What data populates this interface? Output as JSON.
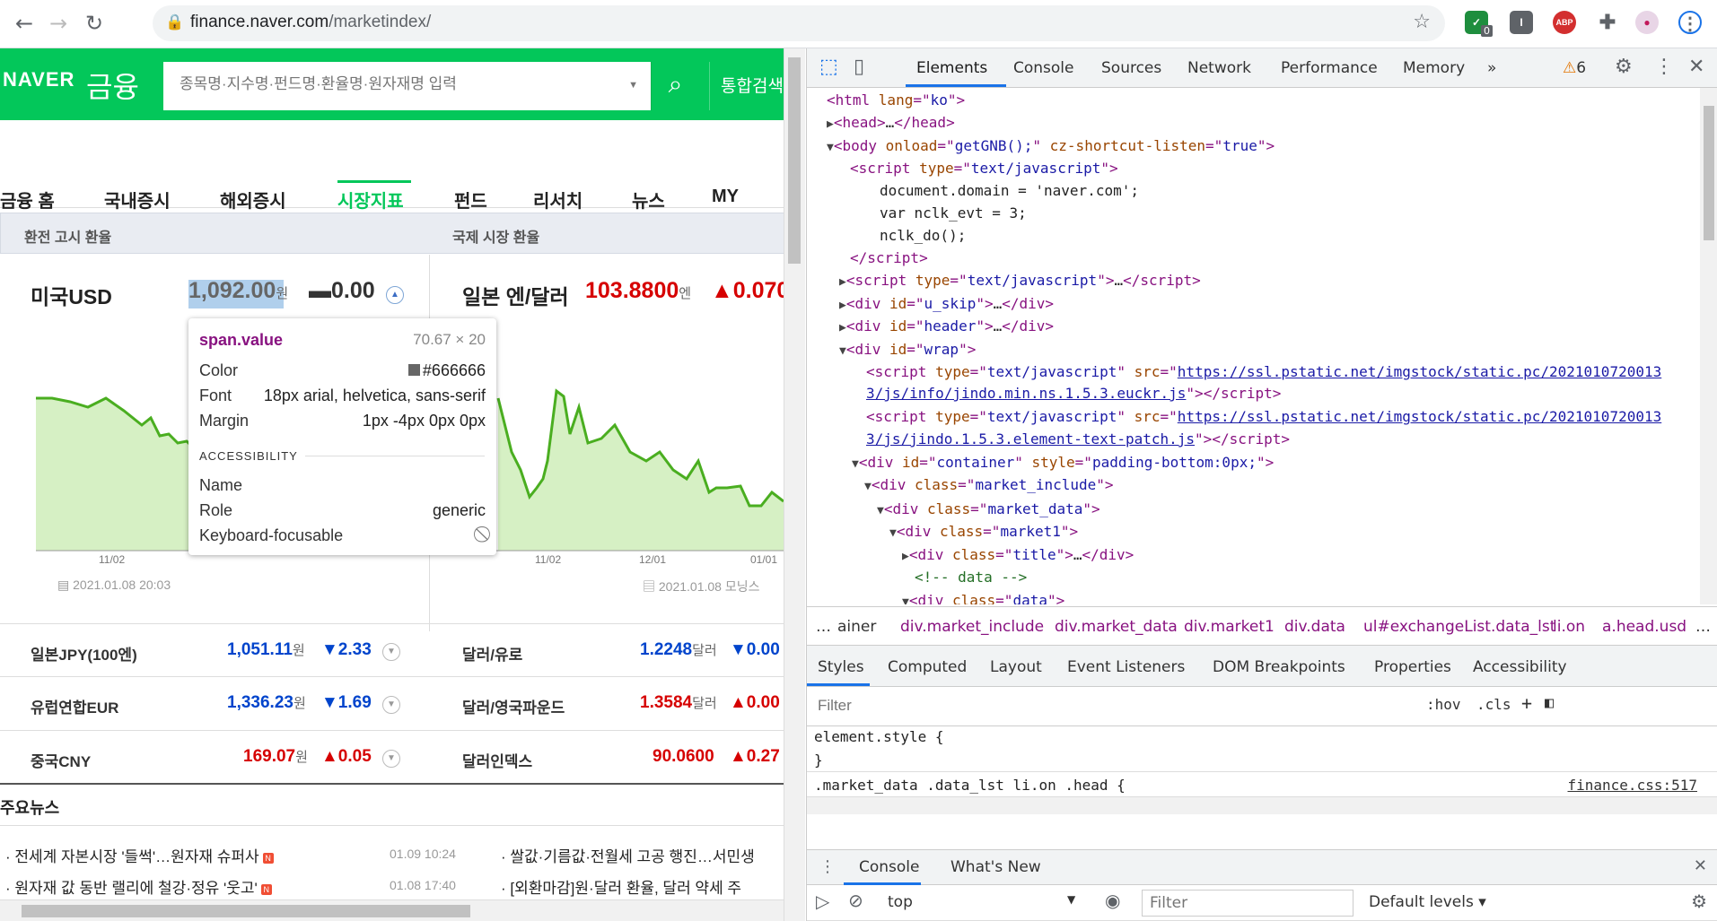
{
  "browser": {
    "url_host": "finance.naver.com",
    "url_path": "/marketindex/",
    "back_glyph": "←",
    "forward_glyph": "→",
    "reload_glyph": "↻",
    "ext_badge_count": "0",
    "ext_abp": "ABP"
  },
  "naver": {
    "logo": "NAVER",
    "logo_sub": "금융",
    "search_placeholder": "종목명·지수명·펀드명·환율명·원자재명 입력",
    "search_all": "통합검색",
    "gnb": [
      "금융 홈",
      "국내증시",
      "해외증시",
      "시장지표",
      "펀드",
      "리서치",
      "뉴스",
      "MY"
    ],
    "panel_left_title": "환전 고시 환율",
    "panel_right_title": "국제 시장 환율",
    "usd": {
      "name": "미국USD",
      "value": "1,092.00",
      "unit": "원",
      "change": "▬0.00"
    },
    "jpy_usd": {
      "name": "일본 엔/달러",
      "value": "103.8800",
      "unit": "엔",
      "change": "▲0.070"
    },
    "left_ticks": [
      "11/02"
    ],
    "right_ticks": [
      "11/02",
      "12/01",
      "01/01"
    ],
    "left_source": "2021.01.08 20:03",
    "right_source": "2021.01.08 모닝스",
    "left_rates": [
      {
        "name": "일본JPY(100엔)",
        "value": "1,051.11",
        "unit": "원",
        "change": "▼2.33",
        "dir": "down"
      },
      {
        "name": "유럽연합EUR",
        "value": "1,336.23",
        "unit": "원",
        "change": "▼1.69",
        "dir": "down"
      },
      {
        "name": "중국CNY",
        "value": "169.07",
        "unit": "원",
        "change": "▲0.05",
        "dir": "up"
      }
    ],
    "right_rates": [
      {
        "name": "달러/유로",
        "value": "1.2248",
        "unit": "달러",
        "change": "▼0.00",
        "dir": "down"
      },
      {
        "name": "달러/영국파운드",
        "value": "1.3584",
        "unit": "달러",
        "change": "▲0.00",
        "dir": "up"
      },
      {
        "name": "달러인덱스",
        "value": "90.0600",
        "unit": "",
        "change": "▲0.27",
        "dir": "up"
      }
    ],
    "news_title": "주요뉴스",
    "news": [
      {
        "text": "전세계 자본시장 '들썩'…원자재 슈퍼사",
        "time": "01.09 10:24"
      },
      {
        "text": "원자재 값 동반 랠리에 철강·정유 '웃고'",
        "time": "01.08 17:40"
      }
    ],
    "news_right": [
      "쌀값·기름값·전월세 고공 행진…서민생",
      "[외환마감]원·달러 환율, 달러 약세 주"
    ]
  },
  "tooltip": {
    "selector": "span.value",
    "dimensions": "70.67 × 20",
    "color_label": "Color",
    "color_value": "#666666",
    "font_label": "Font",
    "font_value": "18px arial, helvetica, sans-serif",
    "margin_label": "Margin",
    "margin_value": "1px -4px 0px 0px",
    "accessibility_header": "ACCESSIBILITY",
    "name_label": "Name",
    "role_label": "Role",
    "role_value": "generic",
    "focusable_label": "Keyboard-focusable"
  },
  "devtools": {
    "tabs": [
      "Elements",
      "Console",
      "Sources",
      "Network",
      "Performance",
      "Memory"
    ],
    "more_tabs": "»",
    "warnings": "6",
    "breadcrumbs": [
      "…",
      "ainer",
      "div.market_include",
      "div.market_data",
      "div.market1",
      "div.data",
      "ul#exchangeList.data_lst",
      "li.on",
      "a.head.usd",
      "…"
    ],
    "panel_tabs": [
      "Styles",
      "Computed",
      "Layout",
      "Event Listeners",
      "DOM Breakpoints",
      "Properties",
      "Accessibility"
    ],
    "styles_filter_placeholder": "Filter",
    "hov": ":hov",
    "cls": ".cls",
    "element_style_open": "element.style {",
    "element_style_close": "}",
    "rule_selector": ".market_data .data_lst li.on .head {",
    "rule_source": "finance.css:517",
    "drawer_tabs": [
      "Console",
      "What's New"
    ],
    "context": "top",
    "console_filter_placeholder": "Filter",
    "levels": "Default levels"
  }
}
